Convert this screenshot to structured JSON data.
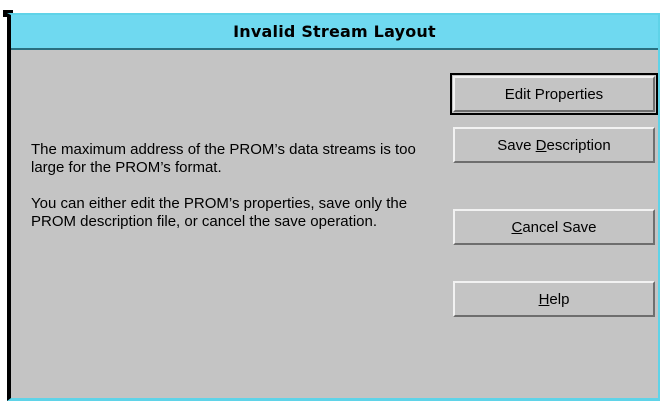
{
  "window": {
    "title": "Invalid Stream Layout"
  },
  "message": {
    "paragraph1": "The maximum address of the PROM’s data streams is too large for the PROM’s format.",
    "paragraph2": "You can either edit the PROM’s properties, save only the PROM description file, or cancel the save operation."
  },
  "buttons": {
    "edit_properties": "Edit Properties",
    "save_description_pre": "Save ",
    "save_description_mnemonic": "D",
    "save_description_post": "escription",
    "cancel_save_pre": "",
    "cancel_save_mnemonic": "C",
    "cancel_save_post": "ancel Save",
    "help_pre": "",
    "help_mnemonic": "H",
    "help_post": "elp"
  },
  "colors": {
    "titlebar": "#6fd9f0",
    "frame_accent": "#5fd3e8",
    "dialog_bg": "#c4c4c4"
  }
}
